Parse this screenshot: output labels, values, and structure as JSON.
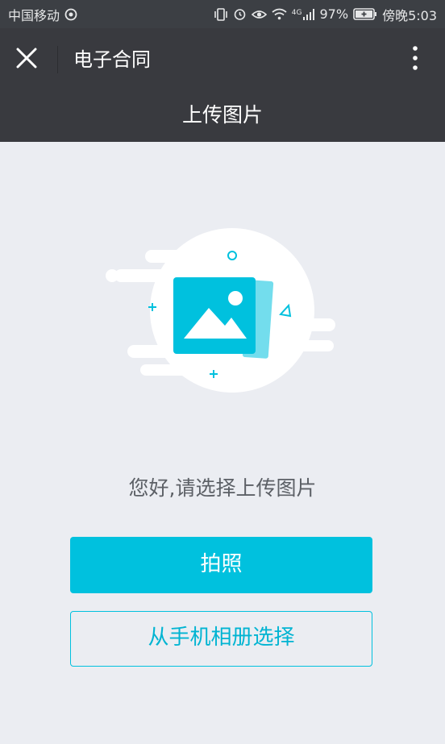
{
  "status_bar": {
    "carrier": "中国移动",
    "battery_percent": "97%",
    "time": "傍晚5:03",
    "network": "4G",
    "icons": [
      "hotspot-icon",
      "vibrate-icon",
      "alarm-icon",
      "eye-icon",
      "wifi-icon",
      "signal-icon",
      "battery-charging-icon"
    ]
  },
  "nav": {
    "title": "电子合同",
    "close_icon": "close-icon",
    "more_icon": "more-vertical-icon"
  },
  "page": {
    "header_title": "上传图片",
    "prompt": "您好,请选择上传图片",
    "take_photo_label": "拍照",
    "choose_album_label": "从手机相册选择"
  },
  "colors": {
    "accent": "#00c1de",
    "nav_bg": "#393a3f",
    "page_bg": "#ebedf2"
  }
}
